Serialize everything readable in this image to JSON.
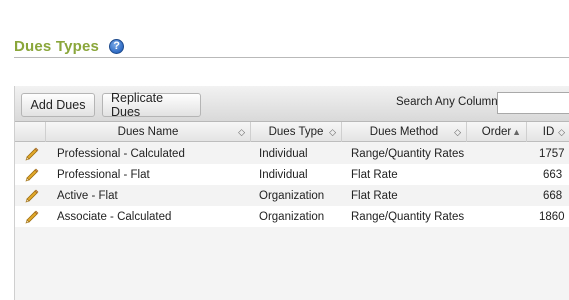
{
  "page": {
    "title": "Dues Types",
    "help_icon": "?"
  },
  "toolbar": {
    "add_label": "Add Dues",
    "replicate_label": "Replicate Dues",
    "search_label": "Search Any Column:",
    "search_value": ""
  },
  "columns": {
    "edit": "",
    "name": "Dues Name",
    "type": "Dues Type",
    "method": "Dues Method",
    "order": "Order",
    "id": "ID"
  },
  "rows": [
    {
      "name": "Professional - Calculated",
      "type": "Individual",
      "method": "Range/Quantity Rates",
      "order": "",
      "id": "1757"
    },
    {
      "name": "Professional - Flat",
      "type": "Individual",
      "method": "Flat Rate",
      "order": "",
      "id": "663"
    },
    {
      "name": "Active - Flat",
      "type": "Organization",
      "method": "Flat Rate",
      "order": "",
      "id": "668"
    },
    {
      "name": "Associate - Calculated",
      "type": "Organization",
      "method": "Range/Quantity Rates",
      "order": "",
      "id": "1860"
    }
  ],
  "icons": {
    "edit": "pencil-icon",
    "sort": "sort-arrows-icon",
    "sort_up": "sort-asc-icon",
    "help": "help-icon"
  },
  "colors": {
    "title": "#8aa63a",
    "help": "#2f6bc4",
    "pencil": "#e2a92a"
  }
}
